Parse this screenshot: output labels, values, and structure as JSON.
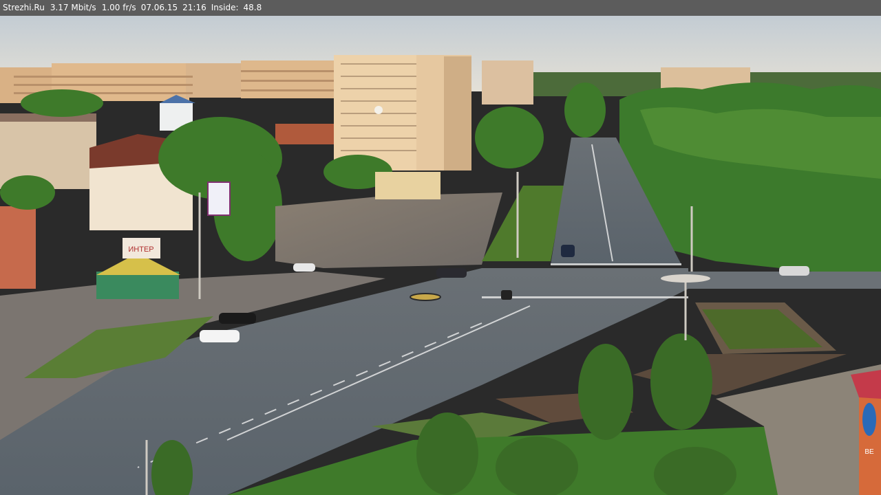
{
  "overlay": {
    "site": "Strezhi.Ru",
    "bitrate": "3.17 Mbit/s",
    "framerate": "1.00 fr/s",
    "date": "07.06.15",
    "time": "21:16",
    "inside_label": "Inside:",
    "inside_value": "48.8"
  },
  "scene": {
    "billboard_text": "ИНТЕР",
    "sign_vertical": "ВЕ"
  },
  "colors": {
    "osd_bar": "#5c5c5c",
    "sky": "#cfd6da",
    "road": "#5f6770",
    "grass": "#4f7a2c",
    "trees": "#3f7a2a",
    "buildings": "#e2b98a"
  }
}
